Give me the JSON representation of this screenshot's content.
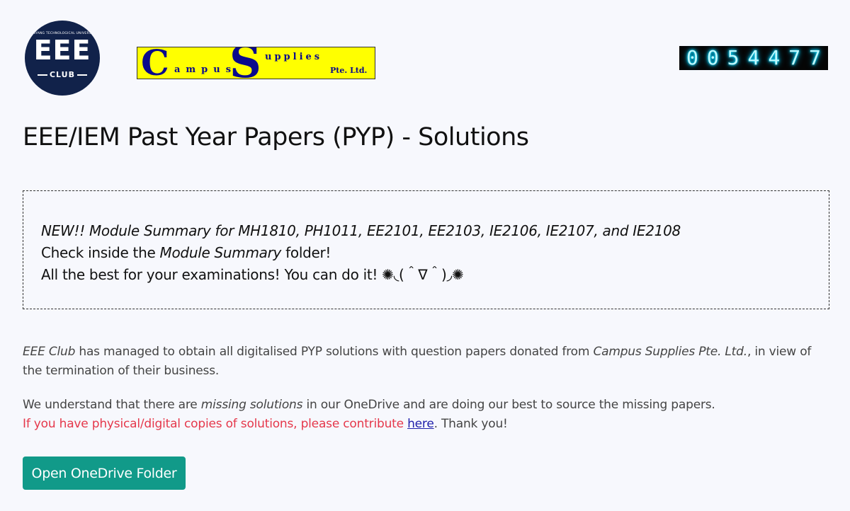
{
  "header": {
    "club_logo": {
      "university_text": "NANYANG TECHNOLOGICAL UNIVERSITY",
      "letters": "EEE",
      "subtext": "CLUB"
    },
    "sponsor_logo": {
      "big_c": "C",
      "campus_rest": "ampus",
      "big_s": "S",
      "upplies": "upplies",
      "pte_ltd": "Pte. Ltd."
    },
    "visit_counter": {
      "digits": [
        "0",
        "0",
        "5",
        "4",
        "4",
        "7",
        "7"
      ]
    }
  },
  "page_title": "EEE/IEM Past Year Papers (PYP) - Solutions",
  "notice": {
    "line1": "NEW!! Module Summary for MH1810, PH1011, EE2101, EE2103, IE2106, IE2107, and IE2108",
    "line2_prefix": "Check inside the ",
    "line2_emphasis": "Module Summary",
    "line2_suffix": " folder!",
    "line3": "All the best for your examinations! You can do it! ✺◟(＾∇＾)◞✺"
  },
  "paragraph1": {
    "club_name": "EEE Club",
    "text_a": " has managed to obtain all digitalised PYP solutions with question papers donated from ",
    "company_name": "Campus Supplies Pte. Ltd.",
    "text_b": ", in view of the termination of their business."
  },
  "paragraph2": {
    "text_a": "We understand that there are ",
    "emphasis": "missing solutions",
    "text_b": " in our OneDrive and are doing our best to source the missing papers.",
    "contribute_text": "If you have physical/digital copies of solutions, please contribute ",
    "link_label": "here",
    "thanks": ". Thank you!"
  },
  "open_button_label": "Open OneDrive Folder",
  "colors": {
    "background": "#f7f8fd",
    "club_navy": "#11224a",
    "sponsor_yellow": "#ffff00",
    "sponsor_blue": "#0a0a8c",
    "counter_glow": "#00e5ff",
    "contribute_red": "#e5384b",
    "link_blue": "#1e1eaa",
    "button_teal": "#119a89"
  }
}
